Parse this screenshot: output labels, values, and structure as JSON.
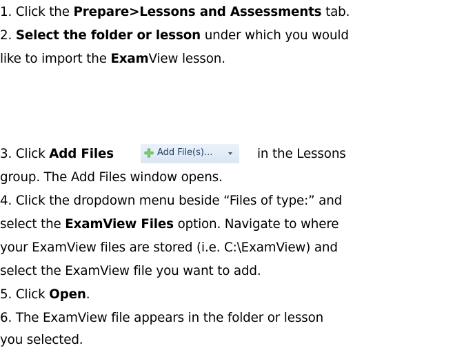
{
  "steps": [
    {
      "num": "1. ",
      "t1": "Click the ",
      "b1": "Prepare>Lessons and Assessments",
      "t2": " tab."
    },
    {
      "num": "2. ",
      "b1": "Select the folder or lesson",
      "t1": " under which you would",
      "t2": "like to import the ",
      "b2": "Exam",
      "t3": "View lesson."
    },
    {
      "num": "3. ",
      "t1": "Click ",
      "b1": "Add Files",
      "button_label": "Add File(s)...",
      "t2": "in the Lessons",
      "t3": "group.  The Add Files window opens."
    },
    {
      "num": "4. ",
      "t1": "Click the dropdown menu beside “Files of type:” and",
      "t2": "select the ",
      "b1": "ExamView Files",
      "t3": " option.  Navigate to where",
      "t4": "your ExamView files are stored (i.e. C:\\ExamView) and",
      "t5": "select the ExamView file you want to add."
    },
    {
      "num": "5. ",
      "t1": "Click ",
      "b1": "Open",
      "t2": "."
    },
    {
      "num": "6. ",
      "t1": "The ExamView file appears in the folder or lesson",
      "t2": "you selected."
    }
  ],
  "icons": {
    "add_files": "green-plus-icon",
    "dropdown": "chevron-down-icon"
  },
  "colors": {
    "text": "#000000",
    "button_bg": "#dbe6f4",
    "button_text": "#1f3b5c",
    "plus_green": "#3aa335"
  }
}
